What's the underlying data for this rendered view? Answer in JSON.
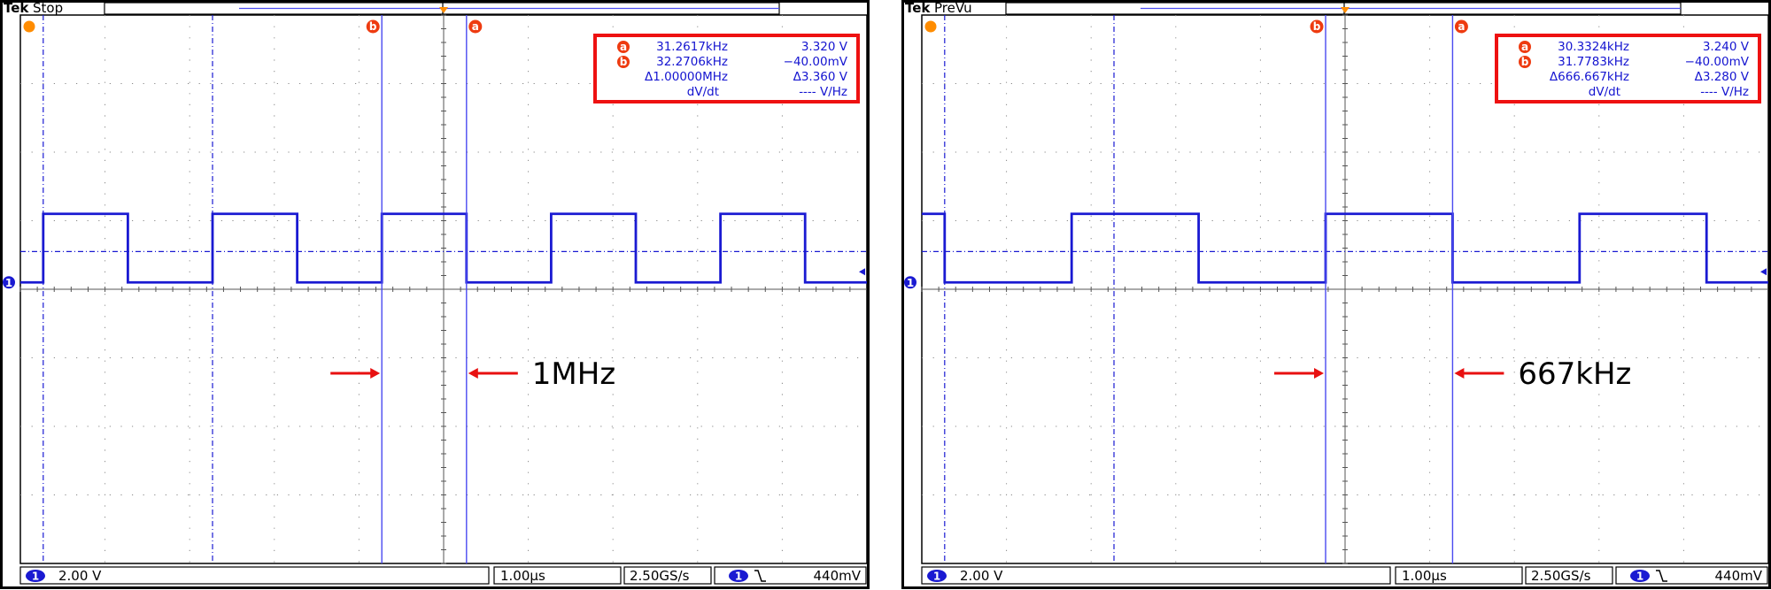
{
  "chart_data": [
    {
      "type": "line",
      "status": "Stop",
      "logo": "Tek",
      "colors": {
        "trace": "#1a1ad2",
        "cursor": "#4a4af0",
        "readout_box": "#ee1111",
        "arrow": "#e81010",
        "trigger": "#ff8c00"
      },
      "grid": true,
      "divisions": {
        "x": 10,
        "y": 8
      },
      "waveform": {
        "high_level_div": 1.1,
        "low_level_div": 0.1,
        "edges_div": [
          0.27,
          1.27,
          2.27,
          3.27,
          4.27,
          5.27,
          6.27,
          7.27,
          8.27,
          9.27
        ],
        "starts_high": false
      },
      "cursors": {
        "b_div": 4.27,
        "a_div": 5.27,
        "a_label": "a",
        "b_label": "b"
      },
      "readout": {
        "a_freq": "31.2617kHz",
        "a_volt": "3.320 V",
        "b_freq": "32.2706kHz",
        "b_volt": "−40.00mV",
        "delta_freq": "Δ1.00000MHz",
        "delta_volt": "Δ3.360 V",
        "rate_label": "dV/dt",
        "rate_value": "---- V/Hz"
      },
      "bottom": {
        "channel": "1",
        "volts_per_div": "2.00 V",
        "time_per_div": "1.00µs",
        "sample_rate": "2.50GS/s",
        "trigger_level": "440mV"
      },
      "annotation": "1MHz"
    },
    {
      "type": "line",
      "status": "PreVu",
      "logo": "Tek",
      "colors": {
        "trace": "#1a1ad2",
        "cursor": "#4a4af0",
        "readout_box": "#ee1111",
        "arrow": "#e81010",
        "trigger": "#ff8c00"
      },
      "grid": true,
      "divisions": {
        "x": 10,
        "y": 8
      },
      "waveform": {
        "high_level_div": 1.1,
        "low_level_div": 0.1,
        "edges_div": [
          0.27,
          1.77,
          3.27,
          4.77,
          6.27,
          7.77,
          9.27
        ],
        "starts_high": true
      },
      "cursors": {
        "b_div": 4.77,
        "a_div": 6.27,
        "a_label": "a",
        "b_label": "b"
      },
      "readout": {
        "a_freq": "30.3324kHz",
        "a_volt": "3.240 V",
        "b_freq": "31.7783kHz",
        "b_volt": "−40.00mV",
        "delta_freq": "Δ666.667kHz",
        "delta_volt": "Δ3.280 V",
        "rate_label": "dV/dt",
        "rate_value": "---- V/Hz"
      },
      "bottom": {
        "channel": "1",
        "volts_per_div": "2.00 V",
        "time_per_div": "1.00µs",
        "sample_rate": "2.50GS/s",
        "trigger_level": "440mV"
      },
      "annotation": "667kHz"
    }
  ]
}
